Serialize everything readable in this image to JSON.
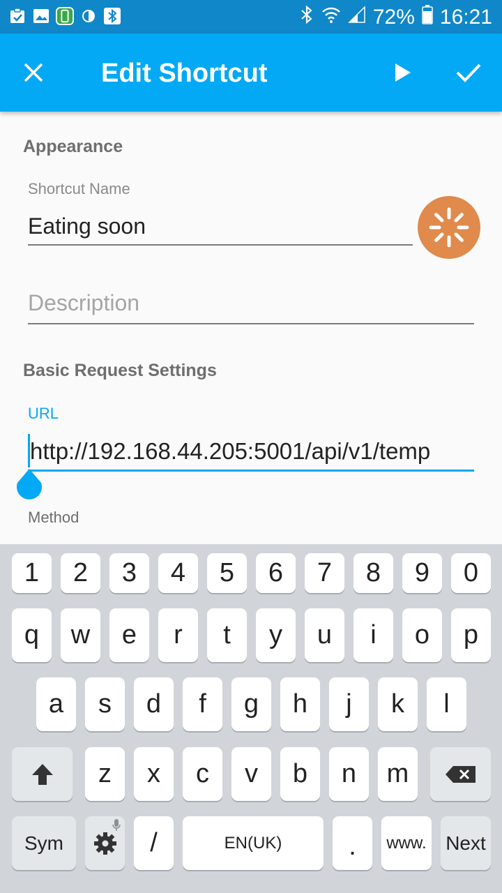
{
  "status_bar": {
    "battery": "72%",
    "time": "16:21"
  },
  "app_bar": {
    "title": "Edit Shortcut"
  },
  "appearance": {
    "header": "Appearance",
    "name_label": "Shortcut Name",
    "name_value": "Eating soon",
    "description_placeholder": "Description"
  },
  "basic": {
    "header": "Basic Request Settings",
    "url_label": "URL",
    "url_value": "http://192.168.44.205:5001/api/v1/temp",
    "method_label": "Method"
  },
  "colors": {
    "status_bar": "#0f87c9",
    "app_bar": "#03a9f4",
    "accent": "#03a9f4",
    "icon_bg": "#e08a4b"
  },
  "keyboard": {
    "row_numbers": [
      "1",
      "2",
      "3",
      "4",
      "5",
      "6",
      "7",
      "8",
      "9",
      "0"
    ],
    "row_top": [
      "q",
      "w",
      "e",
      "r",
      "t",
      "y",
      "u",
      "i",
      "o",
      "p"
    ],
    "row_mid": [
      "a",
      "s",
      "d",
      "f",
      "g",
      "h",
      "j",
      "k",
      "l"
    ],
    "row_bottom": [
      "z",
      "x",
      "c",
      "v",
      "b",
      "n",
      "m"
    ],
    "sym": "Sym",
    "slash": "/",
    "space": "EN(UK)",
    "period": ".",
    "www": "www.",
    "next": "Next"
  }
}
